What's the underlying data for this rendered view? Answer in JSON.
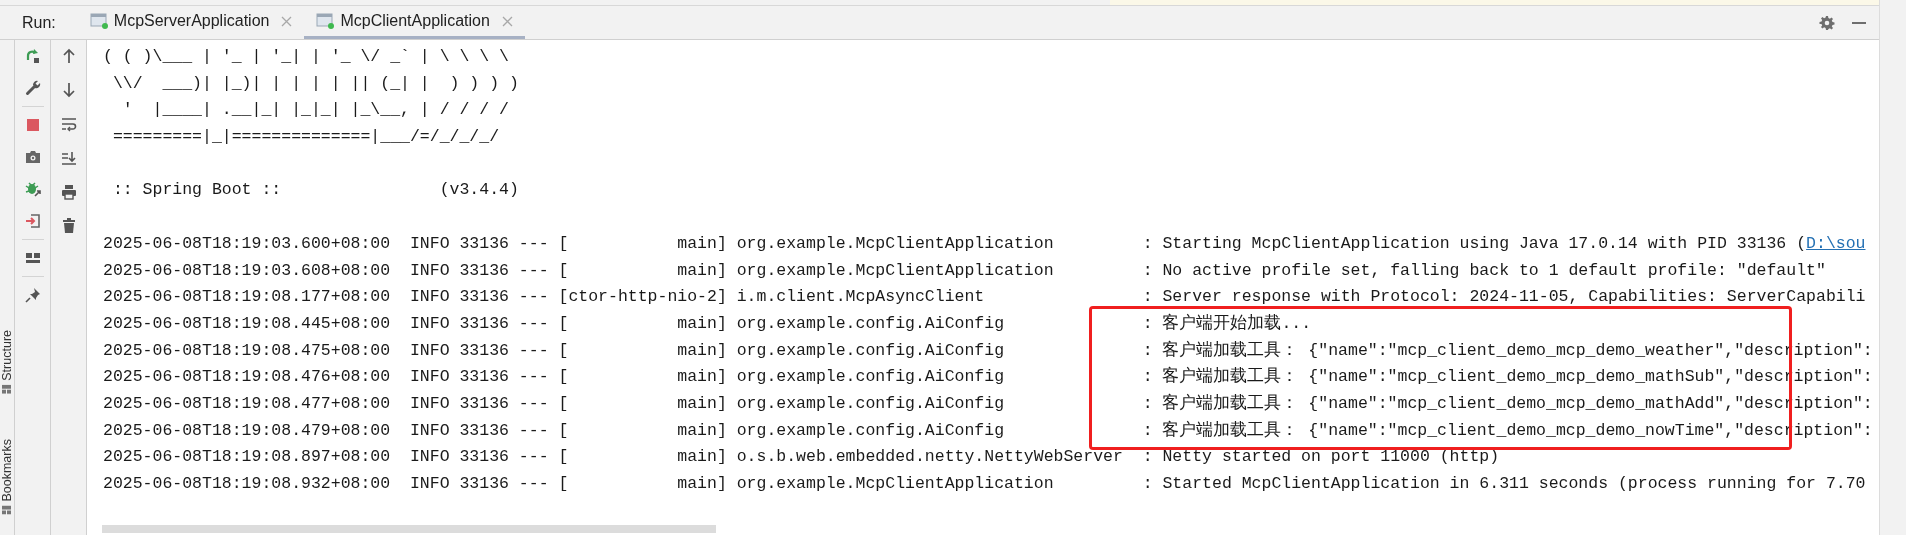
{
  "run_bar": {
    "label": "Run:",
    "tabs": [
      {
        "label": "McpServerApplication",
        "selected": false
      },
      {
        "label": "McpClientApplication",
        "selected": true
      }
    ]
  },
  "side_tabs": [
    {
      "label": "Structure"
    },
    {
      "label": "Bookmarks"
    }
  ],
  "console": {
    "lines": [
      {
        "kind": "text",
        "text": "( ( )\\___ | '_ | '_| | '_ \\/ _` | \\ \\ \\ \\"
      },
      {
        "kind": "text",
        "text": " \\\\/  ___)| |_)| | | | | || (_| |  ) ) ) )"
      },
      {
        "kind": "text",
        "text": "  '  |____| .__|_| |_|_| |_\\__, | / / / /"
      },
      {
        "kind": "text",
        "text": " =========|_|==============|___/=/_/_/_/"
      },
      {
        "kind": "blank"
      },
      {
        "kind": "text",
        "text": " :: Spring Boot ::                (v3.4.4)"
      },
      {
        "kind": "blank"
      },
      {
        "kind": "log",
        "text": "2025-06-08T18:19:03.600+08:00  INFO 33136 --- [           main] org.example.McpClientApplication         : Starting McpClientApplication using Java 17.0.14 with PID 33136 (",
        "link": "D:\\sou",
        "highlighted": false
      },
      {
        "kind": "log",
        "text": "2025-06-08T18:19:03.608+08:00  INFO 33136 --- [           main] org.example.McpClientApplication         : No active profile set, falling back to 1 default profile: \"default\"",
        "highlighted": false
      },
      {
        "kind": "log",
        "text": "2025-06-08T18:19:08.177+08:00  INFO 33136 --- [ctor-http-nio-2] i.m.client.McpAsyncClient                : Server response with Protocol: 2024-11-05, Capabilities: ServerCapabili",
        "highlighted": false
      },
      {
        "kind": "log",
        "text": "2025-06-08T18:19:08.445+08:00  INFO 33136 --- [           main] org.example.config.AiConfig              : 客户端开始加载...",
        "highlighted": true
      },
      {
        "kind": "log",
        "text": "2025-06-08T18:19:08.475+08:00  INFO 33136 --- [           main] org.example.config.AiConfig              : 客户端加载工具： {\"name\":\"mcp_client_demo_mcp_demo_weather\",\"description\":",
        "highlighted": true
      },
      {
        "kind": "log",
        "text": "2025-06-08T18:19:08.476+08:00  INFO 33136 --- [           main] org.example.config.AiConfig              : 客户端加载工具： {\"name\":\"mcp_client_demo_mcp_demo_mathSub\",\"description\":",
        "highlighted": true
      },
      {
        "kind": "log",
        "text": "2025-06-08T18:19:08.477+08:00  INFO 33136 --- [           main] org.example.config.AiConfig              : 客户端加载工具： {\"name\":\"mcp_client_demo_mcp_demo_mathAdd\",\"description\":",
        "highlighted": true
      },
      {
        "kind": "log",
        "text": "2025-06-08T18:19:08.479+08:00  INFO 33136 --- [           main] org.example.config.AiConfig              : 客户端加载工具： {\"name\":\"mcp_client_demo_mcp_demo_nowTime\",\"description\":",
        "highlighted": true
      },
      {
        "kind": "log",
        "text": "2025-06-08T18:19:08.897+08:00  INFO 33136 --- [           main] o.s.b.web.embedded.netty.NettyWebServer  : Netty started on port 11000 (http)",
        "highlighted": false
      },
      {
        "kind": "log",
        "text": "2025-06-08T18:19:08.932+08:00  INFO 33136 --- [           main] org.example.McpClientApplication         : Started McpClientApplication in 6.311 seconds (process running for 7.70",
        "highlighted": false
      }
    ]
  }
}
